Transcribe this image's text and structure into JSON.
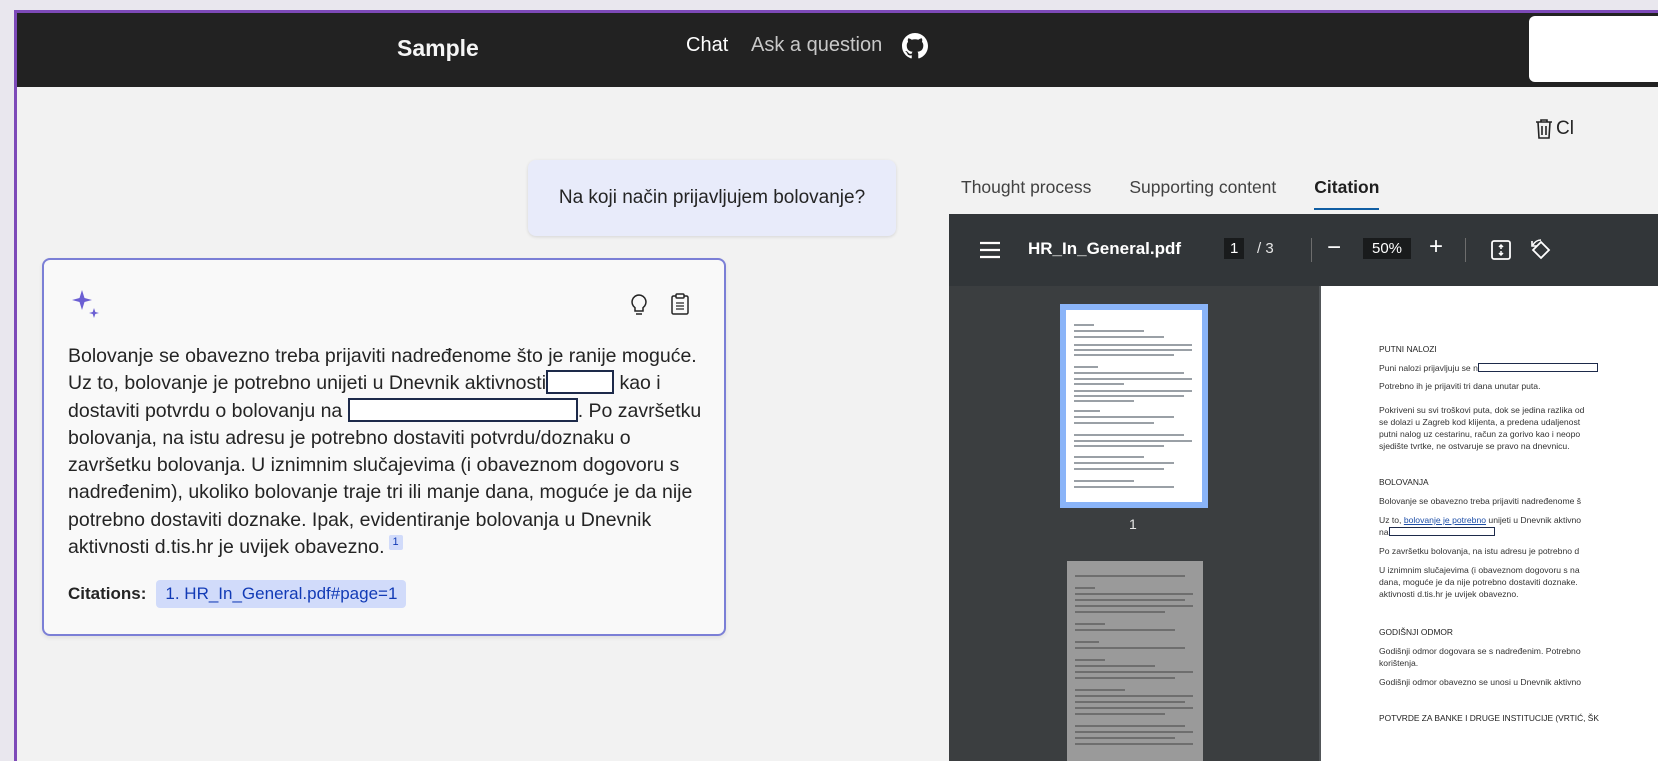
{
  "header": {
    "brand": "Sample",
    "nav_chat": "Chat",
    "nav_ask": "Ask a question"
  },
  "clear_chat": {
    "label": "Cl"
  },
  "question": "Na koji način prijavljujem bolovanje?",
  "answer": {
    "p1": "Bolovanje se obavezno treba prijaviti nadređenome što je ranije moguće. Uz to, bolovanje je potrebno unijeti u Dnevnik aktivnosti",
    "p2": "kao i dostaviti potvrdu o bolovanju na",
    "p3": ". Po završetku bolovanja, na istu adresu je potrebno dostaviti potvrdu/doznaku o završetku bolovanja. U iznimnim slučajevima (i obaveznom dogovoru s nadređenim), ukoliko bolovanje traje tri ili manje dana, moguće je da nije potrebno dostaviti doznake. Ipak, evidentiranje bolovanja u Dnevnik aktivnosti d.tis.hr je uvijek obavezno.",
    "sup": "1",
    "citations_label": "Citations:",
    "citation": "1. HR_In_General.pdf#page=1"
  },
  "tabs": [
    "Thought process",
    "Supporting content",
    "Citation"
  ],
  "active_tab": "Citation",
  "pdf": {
    "filename": "HR_In_General.pdf",
    "page": "1",
    "of": "/  3",
    "zoom": "50%",
    "minus": "−",
    "plus": "+",
    "thumb_label": "1",
    "lines": {
      "h1": "PUTNI NALOZI",
      "l1": "Puni nalozi prijavljuju se n",
      "l2": "Potrebno ih je prijaviti tri dana unutar puta.",
      "l3": "Pokriveni su svi troškovi puta, dok se jedina razlika od",
      "l4": "se dolazi u Zagreb kod klijenta, a predena udaljenost",
      "l5": "putni nalog uz cestarinu, račun za gorivo kao i neopo",
      "l6": "sjedište tvrtke, ne ostvaruje se pravo na dnevnicu.",
      "h2": "BOLOVANJA",
      "l7": "Bolovanje se obavezno treba prijaviti nadređenome š",
      "l8a": "Uz to, ",
      "l8b": "bolovanje je potrebno",
      "l8c": " unijeti u Dnevnik aktivno",
      "l9": "na",
      "l10": "Po završetku bolovanja, na istu adresu je potrebno d",
      "l11": "U iznimnim slučajevima (i obaveznom dogovoru s na",
      "l12": "dana, moguće je da nije potrebno dostaviti doznake.",
      "l13": "aktivnosti d.tis.hr je uvijek obavezno.",
      "h3": "GODIŠNJI ODMOR",
      "l14": "Godišnji odmor dogovara se s nadređenim. Potrebno",
      "l15": "korištenja.",
      "l16": "Godišnji odmor obavezno se unosi u Dnevnik aktivno",
      "h4": "POTVRDE ZA BANKE I DRUGE INSTITUCIJE (VRTIĆ, ŠK"
    }
  },
  "colors": {
    "header_bg": "#222222",
    "frame_accent": "#7d4ab8",
    "question_bg": "#e8ebfa",
    "answer_border": "#7b7fd6",
    "citation_bg": "#d1dbfa",
    "citation_text": "#123bb6",
    "tab_underline": "#115ea3"
  }
}
